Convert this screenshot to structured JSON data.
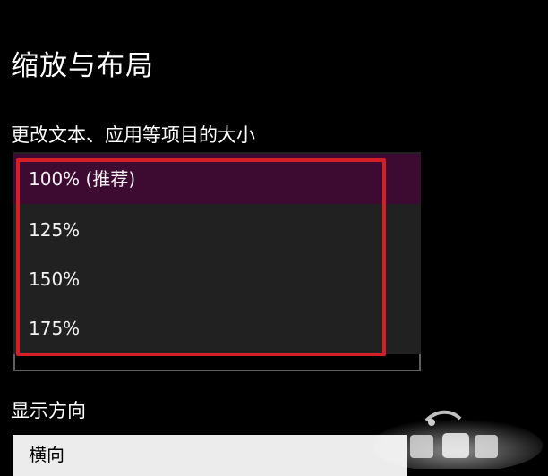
{
  "display_settings": {
    "section_title": "缩放与布局",
    "scale_label": "更改文本、应用等项目的大小",
    "scale_options": [
      {
        "label": "100% (推荐)",
        "selected": true
      },
      {
        "label": "125%",
        "selected": false
      },
      {
        "label": "150%",
        "selected": false
      },
      {
        "label": "175%",
        "selected": false
      }
    ],
    "orientation_label": "显示方向",
    "orientation_value": "横向"
  },
  "colors": {
    "background": "#000000",
    "dropdown_list": "#212121",
    "selected_option": "#3d0a32",
    "highlight_box": "#d41f26",
    "select_box": "#ececec"
  },
  "icons": {
    "watermark": "watermark-logo-icon"
  }
}
